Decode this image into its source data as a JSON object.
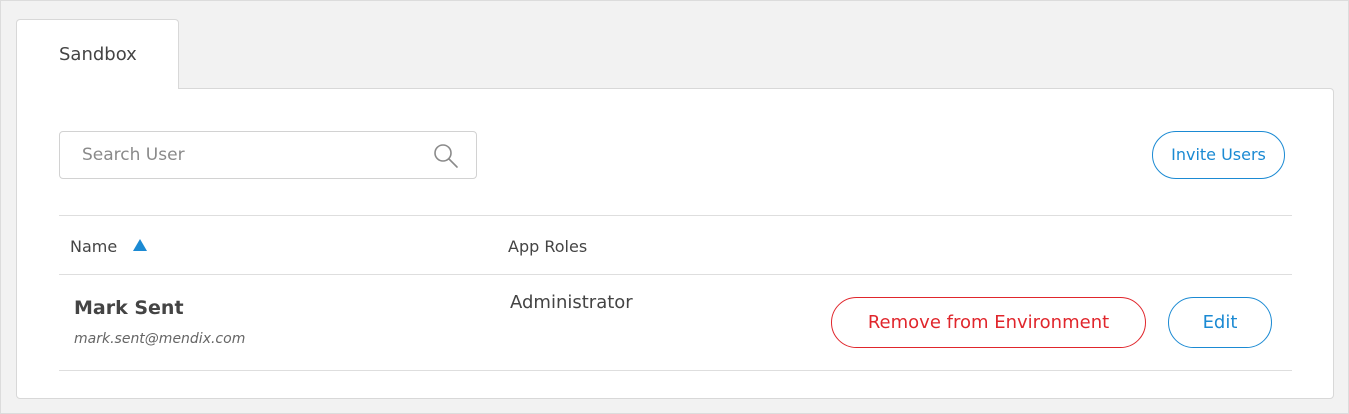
{
  "tabs": [
    {
      "label": "Sandbox",
      "active": true
    }
  ],
  "search": {
    "placeholder": "Search User",
    "value": "",
    "icon": "search-icon"
  },
  "actions": {
    "invite_label": "Invite Users"
  },
  "table": {
    "columns": [
      {
        "label": "Name",
        "sort": "ascending"
      },
      {
        "label": "App Roles"
      }
    ],
    "rows": [
      {
        "name": "Mark Sent",
        "email": "mark.sent@mendix.com",
        "role": "Administrator",
        "remove_label": "Remove from Environment",
        "edit_label": "Edit"
      }
    ]
  },
  "colors": {
    "accent": "#1b8ad3",
    "danger": "#e0262c",
    "text": "#444444",
    "border": "#d8d8d8"
  }
}
